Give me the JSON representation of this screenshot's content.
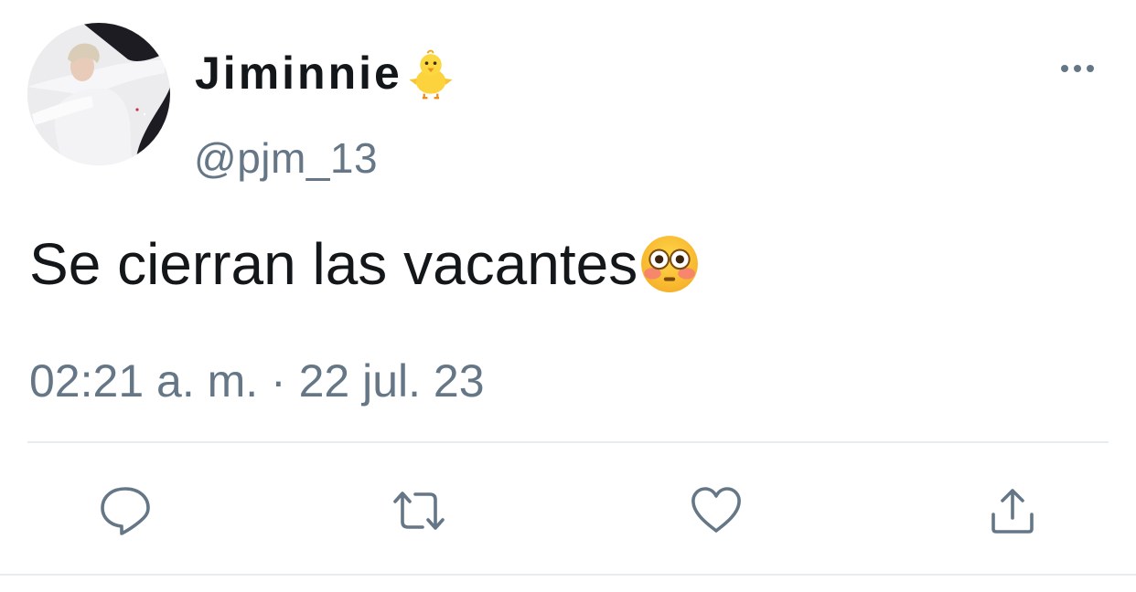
{
  "tweet": {
    "author": {
      "display_name": "Jiminnie",
      "name_emoji": "baby-chick-emoji",
      "handle": "@pjm_13",
      "avatar": "profile-photo"
    },
    "text": "Se cierran las vacantes",
    "text_emoji": "flushed-face-emoji",
    "timestamp": "02:21 a. m. · 22 jul. 23"
  },
  "actions": [
    {
      "name": "reply",
      "icon": "speech-bubble-icon"
    },
    {
      "name": "retweet",
      "icon": "retweet-icon"
    },
    {
      "name": "like",
      "icon": "heart-icon"
    },
    {
      "name": "share",
      "icon": "share-icon"
    }
  ],
  "colors": {
    "text_primary": "#14171a",
    "text_secondary": "#657786",
    "icon": "#657786",
    "divider": "#e6ecf0"
  }
}
